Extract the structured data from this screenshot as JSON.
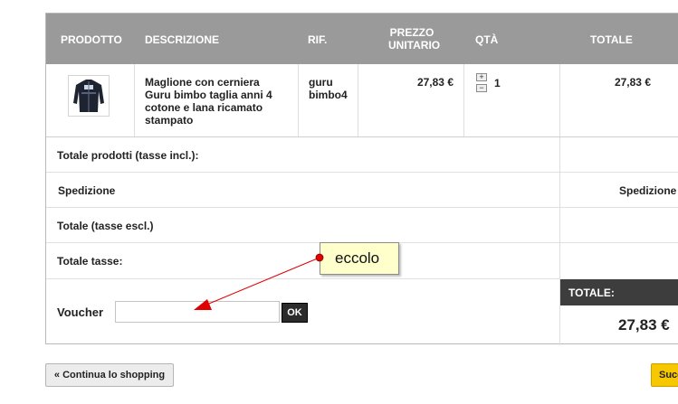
{
  "table": {
    "headers": {
      "product": "PRODOTTO",
      "description": "DESCRIZIONE",
      "ref": "RIF.",
      "unit_price_line1": "PREZZO",
      "unit_price_line2": "UNITARIO",
      "qty": "QTÀ",
      "total": "TOTALE"
    },
    "item": {
      "description_lines": [
        "Maglione con cerniera",
        "Guru bimbo taglia anni 4",
        "cotone e lana ricamato",
        "stampato"
      ],
      "ref_lines": [
        "guru",
        "bimbo4"
      ],
      "unit_price": "27,83 €",
      "qty": "1",
      "plus": "+",
      "minus": "−",
      "total": "27,83 €"
    }
  },
  "summary": {
    "products_total_label": "Totale prodotti (tasse incl.):",
    "shipping_label": "Spedizione",
    "shipping_value": "Spedizione g",
    "total_excl_label": "Totale (tasse escl.)",
    "taxes_label": "Totale tasse:",
    "grand_total_label": "TOTALE:",
    "grand_total_value": "27,83 €"
  },
  "voucher": {
    "label": "Voucher",
    "value": "",
    "ok_label": "OK"
  },
  "buttons": {
    "continue_label": "« Continua lo shopping",
    "next_label": "Succ"
  },
  "annotation": {
    "note_text": "eccolo",
    "arrow_color": "#e00000",
    "note_color": "#ffffcc"
  },
  "colors": {
    "header_bg": "#9a9a9a",
    "total_bar_bg": "#3d3d3d",
    "next_button": "#f7c700"
  }
}
